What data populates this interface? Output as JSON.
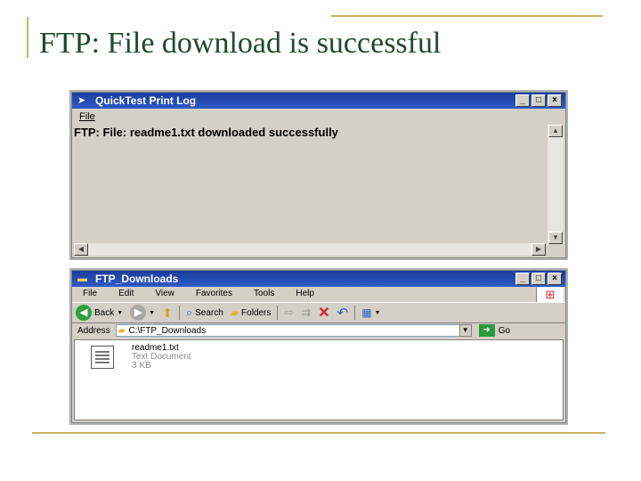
{
  "slide": {
    "title": "FTP: File download is successful"
  },
  "log_window": {
    "title": "QuickTest Print Log",
    "menu_file": "File",
    "message": "FTP: File: readme1.txt downloaded successfully",
    "controls": {
      "minimize": "_",
      "maximize": "□",
      "close": "×"
    }
  },
  "explorer_window": {
    "title": "FTP_Downloads",
    "controls": {
      "minimize": "_",
      "maximize": "□",
      "close": "×"
    },
    "menu": [
      "File",
      "Edit",
      "View",
      "Favorites",
      "Tools",
      "Help"
    ],
    "toolbar": {
      "back": "Back",
      "search": "Search",
      "folders": "Folders"
    },
    "address": {
      "label": "Address",
      "value": "C:\\FTP_Downloads",
      "go": "Go"
    },
    "file": {
      "name": "readme1.txt",
      "type": "Text Document",
      "size": "3 KB"
    }
  },
  "colors": {
    "titlebar": "#2f5bc8",
    "title_text": "#1f4a2c",
    "deco": "#c9b560"
  }
}
